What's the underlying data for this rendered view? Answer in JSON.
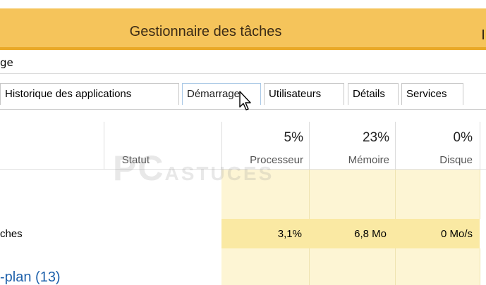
{
  "window": {
    "title": "Gestionnaire des tâches"
  },
  "menu": {
    "item": "ge"
  },
  "tabs": [
    {
      "label": "Historique des applications",
      "active": false
    },
    {
      "label": "Démarrage",
      "active": true
    },
    {
      "label": "Utilisateurs",
      "active": false
    },
    {
      "label": "Détails",
      "active": false
    },
    {
      "label": "Services",
      "active": false
    }
  ],
  "columns": {
    "status": {
      "label": "Statut"
    },
    "cpu": {
      "label": "Processeur",
      "percent": "5%"
    },
    "memory": {
      "label": "Mémoire",
      "percent": "23%"
    },
    "disk": {
      "label": "Disque",
      "percent": "0%"
    }
  },
  "watermark": {
    "big": "PC",
    "small": "ASTUCES"
  },
  "rows": [
    {
      "name": "ches",
      "cpu": "3,1%",
      "memory": "6,8 Mo",
      "disk": "0 Mo/s"
    }
  ],
  "group": {
    "label": "-plan (13)"
  },
  "colors": {
    "titlebar": "#f5c45b",
    "heat": "#fdf5d4",
    "selected": "#fae9a3",
    "link": "#1e61ab"
  }
}
